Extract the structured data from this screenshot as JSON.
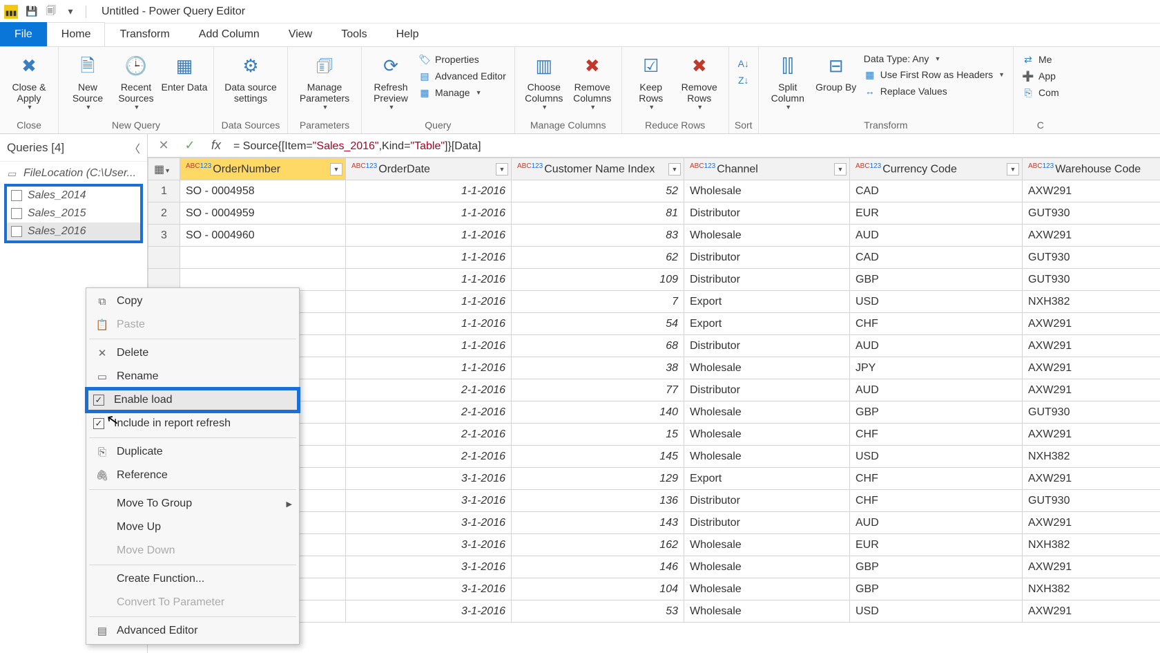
{
  "titlebar": {
    "title": "Untitled - Power Query Editor"
  },
  "tabs": {
    "file": "File",
    "home": "Home",
    "transform": "Transform",
    "addcol": "Add Column",
    "view": "View",
    "tools": "Tools",
    "help": "Help"
  },
  "ribbon": {
    "close_apply": "Close & Apply",
    "close_group": "Close",
    "new_source": "New Source",
    "recent_sources": "Recent Sources",
    "enter_data": "Enter Data",
    "new_query_group": "New Query",
    "data_source_settings": "Data source settings",
    "data_sources_group": "Data Sources",
    "manage_parameters": "Manage Parameters",
    "parameters_group": "Parameters",
    "refresh_preview": "Refresh Preview",
    "properties": "Properties",
    "advanced_editor": "Advanced Editor",
    "manage": "Manage",
    "query_group": "Query",
    "choose_columns": "Choose Columns",
    "remove_columns": "Remove Columns",
    "manage_columns_group": "Manage Columns",
    "keep_rows": "Keep Rows",
    "remove_rows": "Remove Rows",
    "reduce_rows_group": "Reduce Rows",
    "sort_group": "Sort",
    "split_column": "Split Column",
    "group_by": "Group By",
    "data_type": "Data Type: Any",
    "first_row_headers": "Use First Row as Headers",
    "replace_values": "Replace Values",
    "transform_group": "Transform",
    "merge": "Me",
    "append": "App",
    "combine": "Com"
  },
  "formula": {
    "prefix": "= Source{[Item=",
    "item": "\"Sales_2016\"",
    "mid": ",Kind=",
    "kind": "\"Table\"",
    "suffix": "]}[Data]"
  },
  "queries": {
    "header": "Queries [4]",
    "items": [
      {
        "name": "FileLocation (C:\\User...",
        "italic": true,
        "param": true
      },
      {
        "name": "Sales_2014",
        "italic": true
      },
      {
        "name": "Sales_2015",
        "italic": true
      },
      {
        "name": "Sales_2016",
        "italic": true,
        "selected": true
      }
    ]
  },
  "columns": [
    "OrderNumber",
    "OrderDate",
    "Customer Name Index",
    "Channel",
    "Currency Code",
    "Warehouse Code"
  ],
  "rows": [
    [
      "1",
      "SO - 0004958",
      "1-1-2016",
      "52",
      "Wholesale",
      "CAD",
      "AXW291"
    ],
    [
      "2",
      "SO - 0004959",
      "1-1-2016",
      "81",
      "Distributor",
      "EUR",
      "GUT930"
    ],
    [
      "3",
      "SO - 0004960",
      "1-1-2016",
      "83",
      "Wholesale",
      "AUD",
      "AXW291"
    ],
    [
      "",
      "",
      "1-1-2016",
      "62",
      "Distributor",
      "CAD",
      "GUT930"
    ],
    [
      "",
      "",
      "1-1-2016",
      "109",
      "Distributor",
      "GBP",
      "GUT930"
    ],
    [
      "",
      "",
      "1-1-2016",
      "7",
      "Export",
      "USD",
      "NXH382"
    ],
    [
      "",
      "",
      "1-1-2016",
      "54",
      "Export",
      "CHF",
      "AXW291"
    ],
    [
      "",
      "",
      "1-1-2016",
      "68",
      "Distributor",
      "AUD",
      "AXW291"
    ],
    [
      "",
      "",
      "1-1-2016",
      "38",
      "Wholesale",
      "JPY",
      "AXW291"
    ],
    [
      "",
      "",
      "2-1-2016",
      "77",
      "Distributor",
      "AUD",
      "AXW291"
    ],
    [
      "",
      "",
      "2-1-2016",
      "140",
      "Wholesale",
      "GBP",
      "GUT930"
    ],
    [
      "",
      "",
      "2-1-2016",
      "15",
      "Wholesale",
      "CHF",
      "AXW291"
    ],
    [
      "",
      "",
      "2-1-2016",
      "145",
      "Wholesale",
      "USD",
      "NXH382"
    ],
    [
      "",
      "",
      "3-1-2016",
      "129",
      "Export",
      "CHF",
      "AXW291"
    ],
    [
      "",
      "",
      "3-1-2016",
      "136",
      "Distributor",
      "CHF",
      "GUT930"
    ],
    [
      "",
      "",
      "3-1-2016",
      "143",
      "Distributor",
      "AUD",
      "AXW291"
    ],
    [
      "",
      "",
      "3-1-2016",
      "162",
      "Wholesale",
      "EUR",
      "NXH382"
    ],
    [
      "",
      "",
      "3-1-2016",
      "146",
      "Wholesale",
      "GBP",
      "AXW291"
    ],
    [
      "",
      "",
      "3-1-2016",
      "104",
      "Wholesale",
      "GBP",
      "NXH382"
    ],
    [
      "",
      "",
      "3-1-2016",
      "53",
      "Wholesale",
      "USD",
      "AXW291"
    ]
  ],
  "context_menu": {
    "copy": "Copy",
    "paste": "Paste",
    "delete": "Delete",
    "rename": "Rename",
    "enable_load": "Enable load",
    "include_refresh": "Include in report refresh",
    "duplicate": "Duplicate",
    "reference": "Reference",
    "move_group": "Move To Group",
    "move_up": "Move Up",
    "move_down": "Move Down",
    "create_function": "Create Function...",
    "convert_param": "Convert To Parameter",
    "advanced_editor": "Advanced Editor"
  }
}
